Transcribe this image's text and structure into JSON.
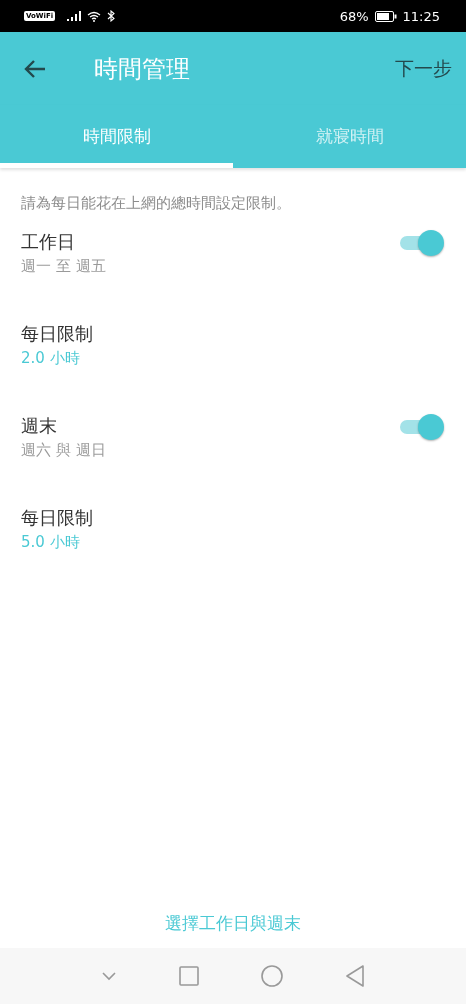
{
  "status_bar": {
    "badge": "VoWiFi",
    "battery": "68%",
    "time": "11:25"
  },
  "header": {
    "title": "時間管理",
    "action": "下一步"
  },
  "tabs": [
    {
      "label": "時間限制",
      "selected": true
    },
    {
      "label": "就寢時間",
      "selected": false
    }
  ],
  "hint": "請為每日能花在上網的總時間設定限制。",
  "rows": [
    {
      "kind": "toggle",
      "title": "工作日",
      "subtitle": "週一 至 週五",
      "on": true
    },
    {
      "kind": "value",
      "title": "每日限制",
      "value": "2.0 小時"
    },
    {
      "kind": "toggle",
      "title": "週末",
      "subtitle": "週六 與 週日",
      "on": true
    },
    {
      "kind": "value",
      "title": "每日限制",
      "value": "5.0 小時"
    }
  ],
  "bottom_link": "選擇工作日與週末"
}
